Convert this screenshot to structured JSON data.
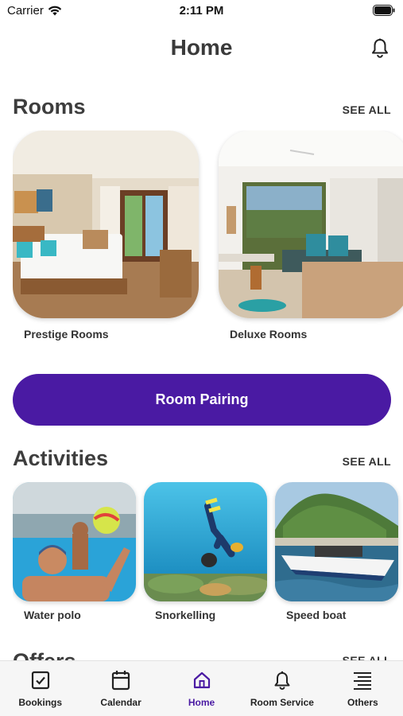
{
  "status_bar": {
    "carrier": "Carrier",
    "time": "2:11 PM"
  },
  "header": {
    "title": "Home"
  },
  "rooms": {
    "title": "Rooms",
    "see_all": "SEE ALL",
    "items": [
      {
        "label": "Prestige Rooms"
      },
      {
        "label": "Deluxe Rooms"
      }
    ]
  },
  "room_pairing": {
    "label": "Room Pairing"
  },
  "activities": {
    "title": "Activities",
    "see_all": "SEE ALL",
    "items": [
      {
        "label": "Water polo"
      },
      {
        "label": "Snorkelling"
      },
      {
        "label": "Speed boat"
      }
    ]
  },
  "offers": {
    "title": "Offers",
    "see_all": "SEE ALL"
  },
  "tab_bar": {
    "items": [
      {
        "label": "Bookings",
        "icon": "checkbox-icon"
      },
      {
        "label": "Calendar",
        "icon": "calendar-icon"
      },
      {
        "label": "Home",
        "icon": "home-icon",
        "active": true
      },
      {
        "label": "Room Service",
        "icon": "bell-icon"
      },
      {
        "label": "Others",
        "icon": "menu-lines-icon"
      }
    ]
  },
  "colors": {
    "primary": "#4a1aa3",
    "text": "#333333",
    "tab_bar_bg": "#f6f6f6"
  }
}
